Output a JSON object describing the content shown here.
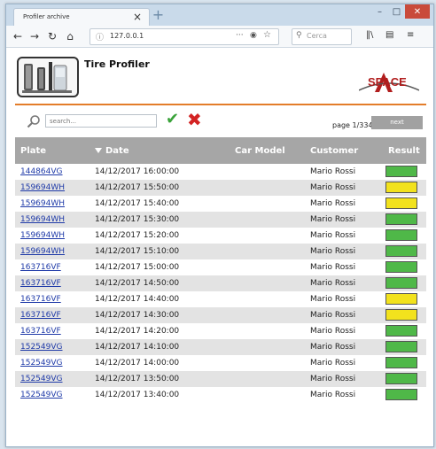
{
  "browser": {
    "tab_title": "Profiler archive",
    "close_glyph": "×",
    "new_tab_glyph": "+",
    "url": "127.0.0.1",
    "search_placeholder": "Cerca",
    "url_more_glyph": "···"
  },
  "app": {
    "title": "Tire Profiler",
    "brand": "SPACE"
  },
  "search": {
    "placeholder": "search...",
    "page_label": "page 1/334",
    "next_label": "next"
  },
  "table": {
    "columns": [
      "Plate",
      "Date",
      "Car Model",
      "Customer",
      "Result"
    ],
    "rows": [
      {
        "plate": "144864VG",
        "date": "14/12/2017 16:00:00",
        "car_model": "",
        "customer": "Mario Rossi",
        "result": "green"
      },
      {
        "plate": "159694WH",
        "date": "14/12/2017 15:50:00",
        "car_model": "",
        "customer": "Mario Rossi",
        "result": "yellow"
      },
      {
        "plate": "159694WH",
        "date": "14/12/2017 15:40:00",
        "car_model": "",
        "customer": "Mario Rossi",
        "result": "yellow"
      },
      {
        "plate": "159694WH",
        "date": "14/12/2017 15:30:00",
        "car_model": "",
        "customer": "Mario Rossi",
        "result": "green"
      },
      {
        "plate": "159694WH",
        "date": "14/12/2017 15:20:00",
        "car_model": "",
        "customer": "Mario Rossi",
        "result": "green"
      },
      {
        "plate": "159694WH",
        "date": "14/12/2017 15:10:00",
        "car_model": "",
        "customer": "Mario Rossi",
        "result": "green"
      },
      {
        "plate": "163716VF",
        "date": "14/12/2017 15:00:00",
        "car_model": "",
        "customer": "Mario Rossi",
        "result": "green"
      },
      {
        "plate": "163716VF",
        "date": "14/12/2017 14:50:00",
        "car_model": "",
        "customer": "Mario Rossi",
        "result": "green"
      },
      {
        "plate": "163716VF",
        "date": "14/12/2017 14:40:00",
        "car_model": "",
        "customer": "Mario Rossi",
        "result": "yellow"
      },
      {
        "plate": "163716VF",
        "date": "14/12/2017 14:30:00",
        "car_model": "",
        "customer": "Mario Rossi",
        "result": "yellow"
      },
      {
        "plate": "163716VF",
        "date": "14/12/2017 14:20:00",
        "car_model": "",
        "customer": "Mario Rossi",
        "result": "green"
      },
      {
        "plate": "152549VG",
        "date": "14/12/2017 14:10:00",
        "car_model": "",
        "customer": "Mario Rossi",
        "result": "green"
      },
      {
        "plate": "152549VG",
        "date": "14/12/2017 14:00:00",
        "car_model": "",
        "customer": "Mario Rossi",
        "result": "green"
      },
      {
        "plate": "152549VG",
        "date": "14/12/2017 13:50:00",
        "car_model": "",
        "customer": "Mario Rossi",
        "result": "green"
      },
      {
        "plate": "152549VG",
        "date": "14/12/2017 13:40:00",
        "car_model": "",
        "customer": "Mario Rossi",
        "result": "green"
      }
    ]
  },
  "colors": {
    "green": "#4fb848",
    "yellow": "#f2e21d",
    "accent_orange": "#e37d2a",
    "header_gray": "#a6a6a6",
    "link_blue": "#1f3aa8",
    "brand_red": "#b11d1d"
  }
}
